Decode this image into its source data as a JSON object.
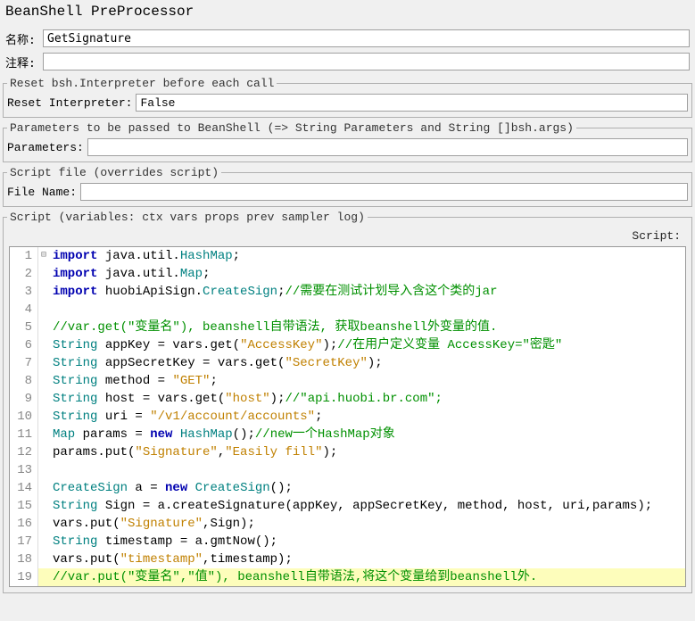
{
  "title": "BeanShell PreProcessor",
  "nameLabel": "名称:",
  "nameValue": "GetSignature",
  "commentLabel": "注释:",
  "commentValue": "",
  "resetGroup": {
    "legend": "Reset bsh.Interpreter before each call",
    "label": "Reset Interpreter:",
    "value": "False"
  },
  "paramsGroup": {
    "legend": "Parameters to be passed to BeanShell (=> String Parameters and String []bsh.args)",
    "label": "Parameters:",
    "value": ""
  },
  "fileGroup": {
    "legend": "Script file (overrides script)",
    "label": "File Name:",
    "value": ""
  },
  "scriptGroup": {
    "legend": "Script (variables: ctx vars props prev sampler log)",
    "rightLabel": "Script:"
  },
  "code": {
    "l1_kw": "import",
    "l1_pkg": " java.util.",
    "l1_cls": "HashMap",
    "l1_end": ";",
    "l2_kw": "import",
    "l2_pkg": " java.util.",
    "l2_cls": "Map",
    "l2_end": ";",
    "l3_kw": "import",
    "l3_pkg": " huobiApiSign.",
    "l3_cls": "CreateSign",
    "l3_end": ";",
    "l3_cmt": "//需要在测试计划导入含这个类的jar",
    "l5_cmt": "//var.get(\"变量名\"), beanshell自带语法, 获取beanshell外变量的值.",
    "l6_a": "String",
    "l6_b": " appKey = vars.get(",
    "l6_s": "\"AccessKey\"",
    "l6_c": ");",
    "l6_cmt": "//在用户定义变量 AccessKey=\"密匙\"",
    "l7_a": "String",
    "l7_b": " appSecretKey = vars.get(",
    "l7_s": "\"SecretKey\"",
    "l7_c": ");",
    "l8_a": "String",
    "l8_b": " method = ",
    "l8_s": "\"GET\"",
    "l8_c": ";",
    "l9_a": "String",
    "l9_b": " host = vars.get(",
    "l9_s": "\"host\"",
    "l9_c": ");",
    "l9_cmt": "//\"api.huobi.br.com\";",
    "l10_a": "String",
    "l10_b": " uri = ",
    "l10_s": "\"/v1/account/accounts\"",
    "l10_c": ";",
    "l11_a": "Map",
    "l11_b": " params = ",
    "l11_kw": "new",
    "l11_c": " ",
    "l11_cls": "HashMap",
    "l11_d": "();",
    "l11_cmt": "//new一个HashMap对象",
    "l12_a": "params.put(",
    "l12_s1": "\"Signature\"",
    "l12_b": ",",
    "l12_s2": "\"Easily fill\"",
    "l12_c": ");",
    "l14_a": "CreateSign",
    "l14_b": " a = ",
    "l14_kw": "new",
    "l14_c": " ",
    "l14_cls": "CreateSign",
    "l14_d": "();",
    "l15_a": "String",
    "l15_b": " Sign = a.createSignature(appKey, appSecretKey, method, host, uri,params);",
    "l16_a": "vars.put(",
    "l16_s": "\"Signature\"",
    "l16_b": ",Sign);",
    "l17_a": "String",
    "l17_b": " timestamp = a.gmtNow();",
    "l18_a": "vars.put(",
    "l18_s": "\"timestamp\"",
    "l18_b": ",timestamp);",
    "l19_cmt": "//var.put(\"变量名\",\"值\"), beanshell自带语法,将这个变量给到beanshell外."
  },
  "ln": {
    "1": "1",
    "2": "2",
    "3": "3",
    "4": "4",
    "5": "5",
    "6": "6",
    "7": "7",
    "8": "8",
    "9": "9",
    "10": "10",
    "11": "11",
    "12": "12",
    "13": "13",
    "14": "14",
    "15": "15",
    "16": "16",
    "17": "17",
    "18": "18",
    "19": "19"
  },
  "fold1": "⊟"
}
